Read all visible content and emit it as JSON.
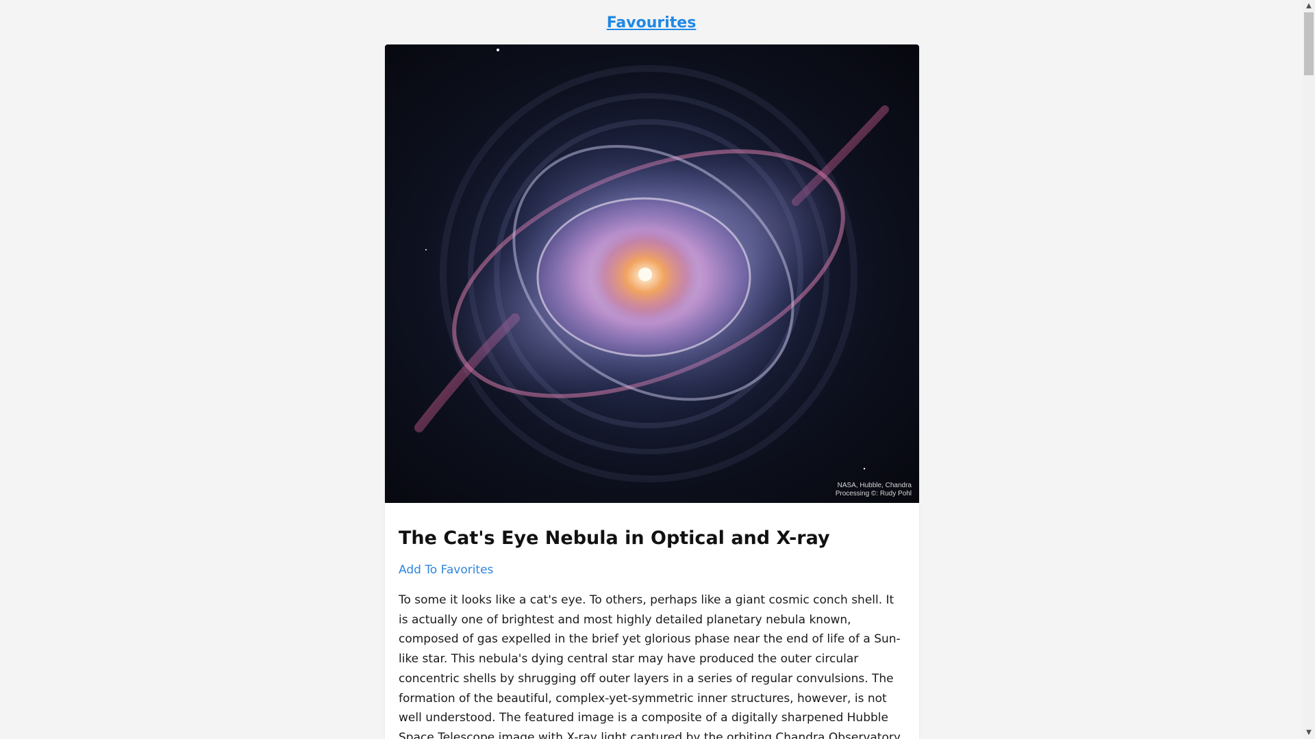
{
  "nav": {
    "favourites_label": "Favourites"
  },
  "apod": {
    "title": "The Cat's Eye Nebula in Optical and X-ray",
    "add_favorites_label": "Add To Favorites",
    "image_credit_line1": "NASA, Hubble, Chandra",
    "image_credit_line2": "Processing ©: Rudy Pohl",
    "explanation": "To some it looks like a cat's eye. To others, perhaps like a giant cosmic conch shell. It is actually one of brightest and most highly detailed planetary nebula known, composed of gas expelled in the brief yet glorious phase near the end of life of a Sun-like star. This nebula's dying central star may have produced the outer circular concentric shells by shrugging off outer layers in a series of regular convulsions. The formation of the beautiful, complex-yet-symmetric inner structures, however, is not well understood. The featured image is a composite of a digitally sharpened Hubble Space Telescope image with X-ray light captured by the orbiting Chandra Observatory. The exquisite floating space statue"
  },
  "colors": {
    "link": "#1e88e5",
    "background": "#f4f4f4",
    "card": "#ffffff"
  },
  "icons": {
    "scroll_up": "chevron-up-icon",
    "scroll_down": "chevron-down-icon"
  }
}
